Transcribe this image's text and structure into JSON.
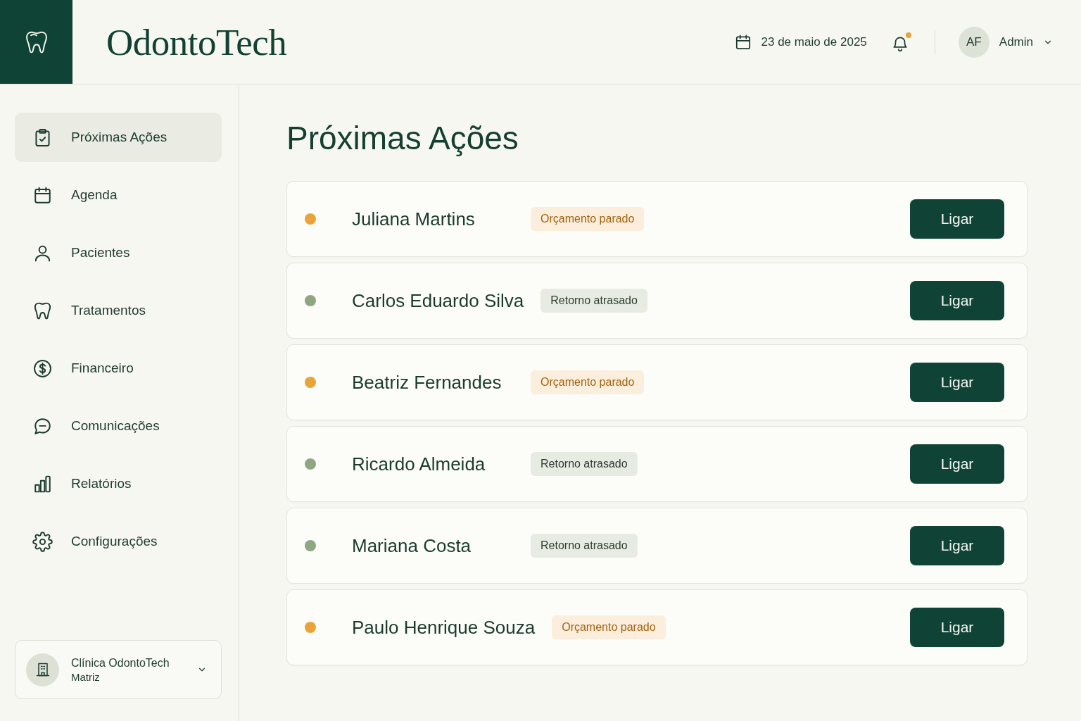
{
  "header": {
    "app_title": "OdontoTech",
    "date": "23 de maio de 2025",
    "notifications": {
      "unread": true
    },
    "user": {
      "initials": "AF",
      "name": "Admin"
    }
  },
  "sidebar": {
    "items": [
      {
        "label": "Próximas Ações",
        "selected": true
      },
      {
        "label": "Agenda",
        "selected": false
      },
      {
        "label": "Pacientes",
        "selected": false
      },
      {
        "label": "Tratamentos",
        "selected": false
      },
      {
        "label": "Financeiro",
        "selected": false
      },
      {
        "label": "Comunicações",
        "selected": false
      },
      {
        "label": "Relatórios",
        "selected": false
      },
      {
        "label": "Configurações",
        "selected": false
      }
    ],
    "clinic": {
      "name": "Clínica OdontoTech",
      "branch": "Matriz"
    }
  },
  "main": {
    "title": "Próximas Ações",
    "actions": [
      {
        "name": "Juliana Martins",
        "color": "#e8a43a",
        "tag": {
          "label": "Orçamento parado",
          "kind": "stalled"
        },
        "button": "Ligar"
      },
      {
        "name": "Carlos Eduardo Silva",
        "color": "#8fa682",
        "tag": {
          "label": "Retorno atrasado",
          "kind": "overdue"
        },
        "button": "Ligar"
      },
      {
        "name": "Beatriz Fernandes",
        "color": "#e8a43a",
        "tag": {
          "label": "Orçamento parado",
          "kind": "stalled"
        },
        "button": "Ligar"
      },
      {
        "name": "Ricardo Almeida",
        "color": "#8fa682",
        "tag": {
          "label": "Retorno atrasado",
          "kind": "overdue"
        },
        "button": "Ligar"
      },
      {
        "name": "Mariana Costa",
        "color": "#8fa682",
        "tag": {
          "label": "Retorno atrasado",
          "kind": "overdue"
        },
        "button": "Ligar"
      },
      {
        "name": "Paulo Henrique Souza",
        "color": "#e8a43a",
        "tag": {
          "label": "Orçamento parado",
          "kind": "stalled"
        },
        "button": "Ligar"
      }
    ]
  }
}
